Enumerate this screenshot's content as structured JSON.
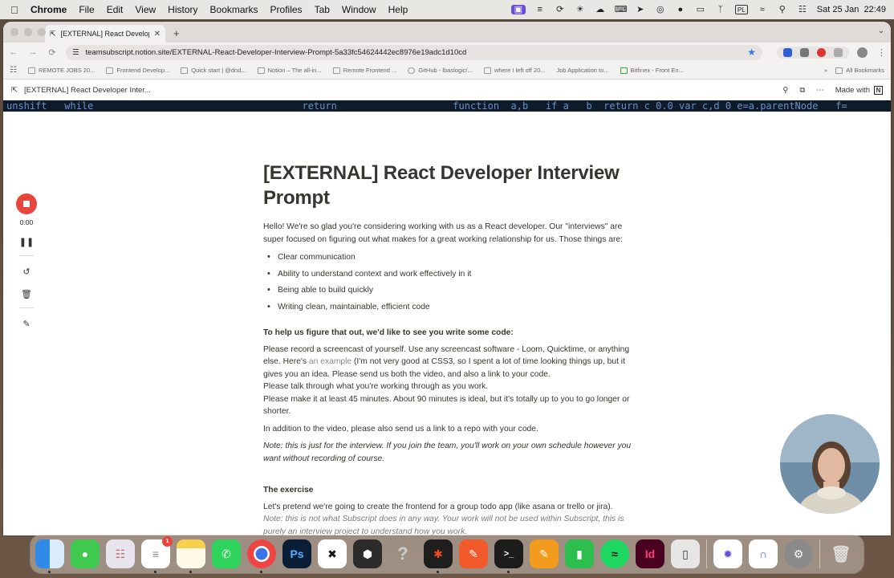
{
  "menubar": {
    "app": "Chrome",
    "items": [
      "File",
      "Edit",
      "View",
      "History",
      "Bookmarks",
      "Profiles",
      "Tab",
      "Window",
      "Help"
    ],
    "status_icons": [
      "screen-record-icon",
      "notes-icon",
      "sync-icon",
      "brightness-icon",
      "cloud-icon",
      "keyboard-icon",
      "location-icon",
      "radio-icon",
      "record-icon",
      "cast-icon",
      "bluetooth-icon",
      "input-source-icon",
      "wifi-icon",
      "search-icon",
      "control-center-icon"
    ],
    "input_source": "PL",
    "datetime": "Sat 25 Jan  22:49"
  },
  "browser": {
    "tab_title": "[EXTERNAL] React Develope",
    "url": "teamsubscript.notion.site/EXTERNAL-React-Developer-Interview-Prompt-5a33fc54624442ec8976e19adc1d10cd",
    "bookmarks": [
      "REMOTE JOBS 20...",
      "Frontend Develop...",
      "Quick start | @dnd...",
      "Notion – The all-in...",
      "Remote Frontend ...",
      "GitHub - lbaslogic/...",
      "where I left off 20...",
      "Job Application to...",
      "Bitfinex - Front En..."
    ],
    "all_bookmarks": "All Bookmarks"
  },
  "notion": {
    "breadcrumb": "[EXTERNAL] React Developer Inter...",
    "made_with": "Made with",
    "cover_code": "unshift   while                                    return                    function  a,b   if a   b  return c 0.0 var c,d 0 e=a.parentNode   f="
  },
  "recorder": {
    "time": "0:00"
  },
  "page": {
    "title": "[EXTERNAL] React Developer Interview Prompt",
    "intro": "Hello! We're so glad you're considering working with us as a React developer. Our \"interviews\" are super focused on figuring out what makes for a great working relationship for us. Those things are:",
    "bullets": [
      "Clear communication",
      "Ability to understand context and work effectively in it",
      "Being able to build quickly",
      "Writing clean, maintainable, efficient code"
    ],
    "code_heading": "To help us figure that out, we'd like to see you write some code:",
    "para1_a": "Please record a screencast of yourself. Use any screencast software - Loom, Quicktime, or anything else. Here's ",
    "para1_link": "an example",
    "para1_b": " (I'm not very good at CSS3, so I spent a lot of time looking things up, but it gives you an idea. Please send us both the video, and also a link to your code.",
    "para1_c": "Please talk through what you're working through as you work.",
    "para1_d": "Please make it at least 45 minutes. About 90 minutes is ideal, but it's totally up to you to go longer or shorter.",
    "para2": "In addition to the video, please also send us a link to a repo with your code.",
    "note1": "Note: this is just for the interview. If you join the team, you'll work on your own schedule however you want without recording of course.",
    "exercise_heading": "The exercise",
    "exercise_p": "Let's pretend we're going to create the frontend for a group todo app (like asana or trello or jira).",
    "note2": "Note: this is not what Subscript does in any way. Your work will not be used within Subscript, this is purely an interview project to understand how you work."
  },
  "dock": {
    "apps": [
      "Finder",
      "Messages",
      "Launchpad",
      "Reminders",
      "Notes",
      "WhatsApp",
      "Chrome",
      "Photoshop",
      "CapCut",
      "Xcode Tool",
      "Unknown",
      "Figma",
      "Pencil",
      "Terminal",
      "Pages",
      "Numbers",
      "Spotify",
      "InDesign",
      "Phone Mirroring",
      "Perplexity",
      "Arc",
      "System Settings",
      "Trash"
    ],
    "reminders_badge": "1",
    "photoshop_label": "Ps",
    "indesign_label": "Id"
  }
}
